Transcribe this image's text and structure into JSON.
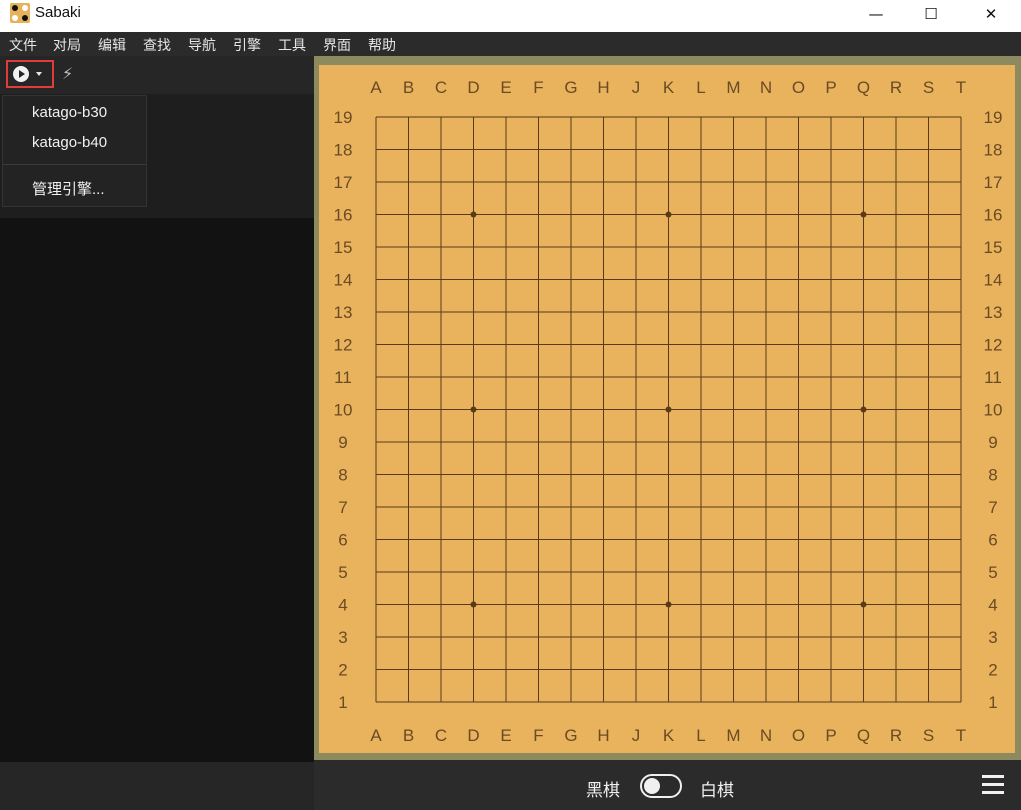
{
  "window": {
    "title": "Sabaki",
    "controls": {
      "minimize": "—",
      "maximize": "☐",
      "close": "✕"
    }
  },
  "menu": [
    "文件",
    "对局",
    "编辑",
    "查找",
    "导航",
    "引擎",
    "工具",
    "界面",
    "帮助"
  ],
  "toolbar": {
    "engine_button_icon": "play-circle-icon",
    "attach_icon": "lightning-icon"
  },
  "engine_dropdown": {
    "items": [
      "katago-b30",
      "katago-b40"
    ],
    "manage": "管理引擎..."
  },
  "board": {
    "columns": [
      "A",
      "B",
      "C",
      "D",
      "E",
      "F",
      "G",
      "H",
      "J",
      "K",
      "L",
      "M",
      "N",
      "O",
      "P",
      "Q",
      "R",
      "S",
      "T"
    ],
    "rows": [
      "19",
      "18",
      "17",
      "16",
      "15",
      "14",
      "13",
      "12",
      "11",
      "10",
      "9",
      "8",
      "7",
      "6",
      "5",
      "4",
      "3",
      "2",
      "1"
    ],
    "star_points": [
      "D16",
      "K16",
      "Q16",
      "D10",
      "K10",
      "Q10",
      "D4",
      "K4",
      "Q4"
    ]
  },
  "status_bar": {
    "black_label": "黑棋",
    "white_label": "白棋",
    "menu_icon": "hamburger-menu-icon"
  },
  "colors": {
    "board_wood": "#e8b35c",
    "grid_line": "#5a3a1a",
    "highlight": "#e23b3b"
  }
}
